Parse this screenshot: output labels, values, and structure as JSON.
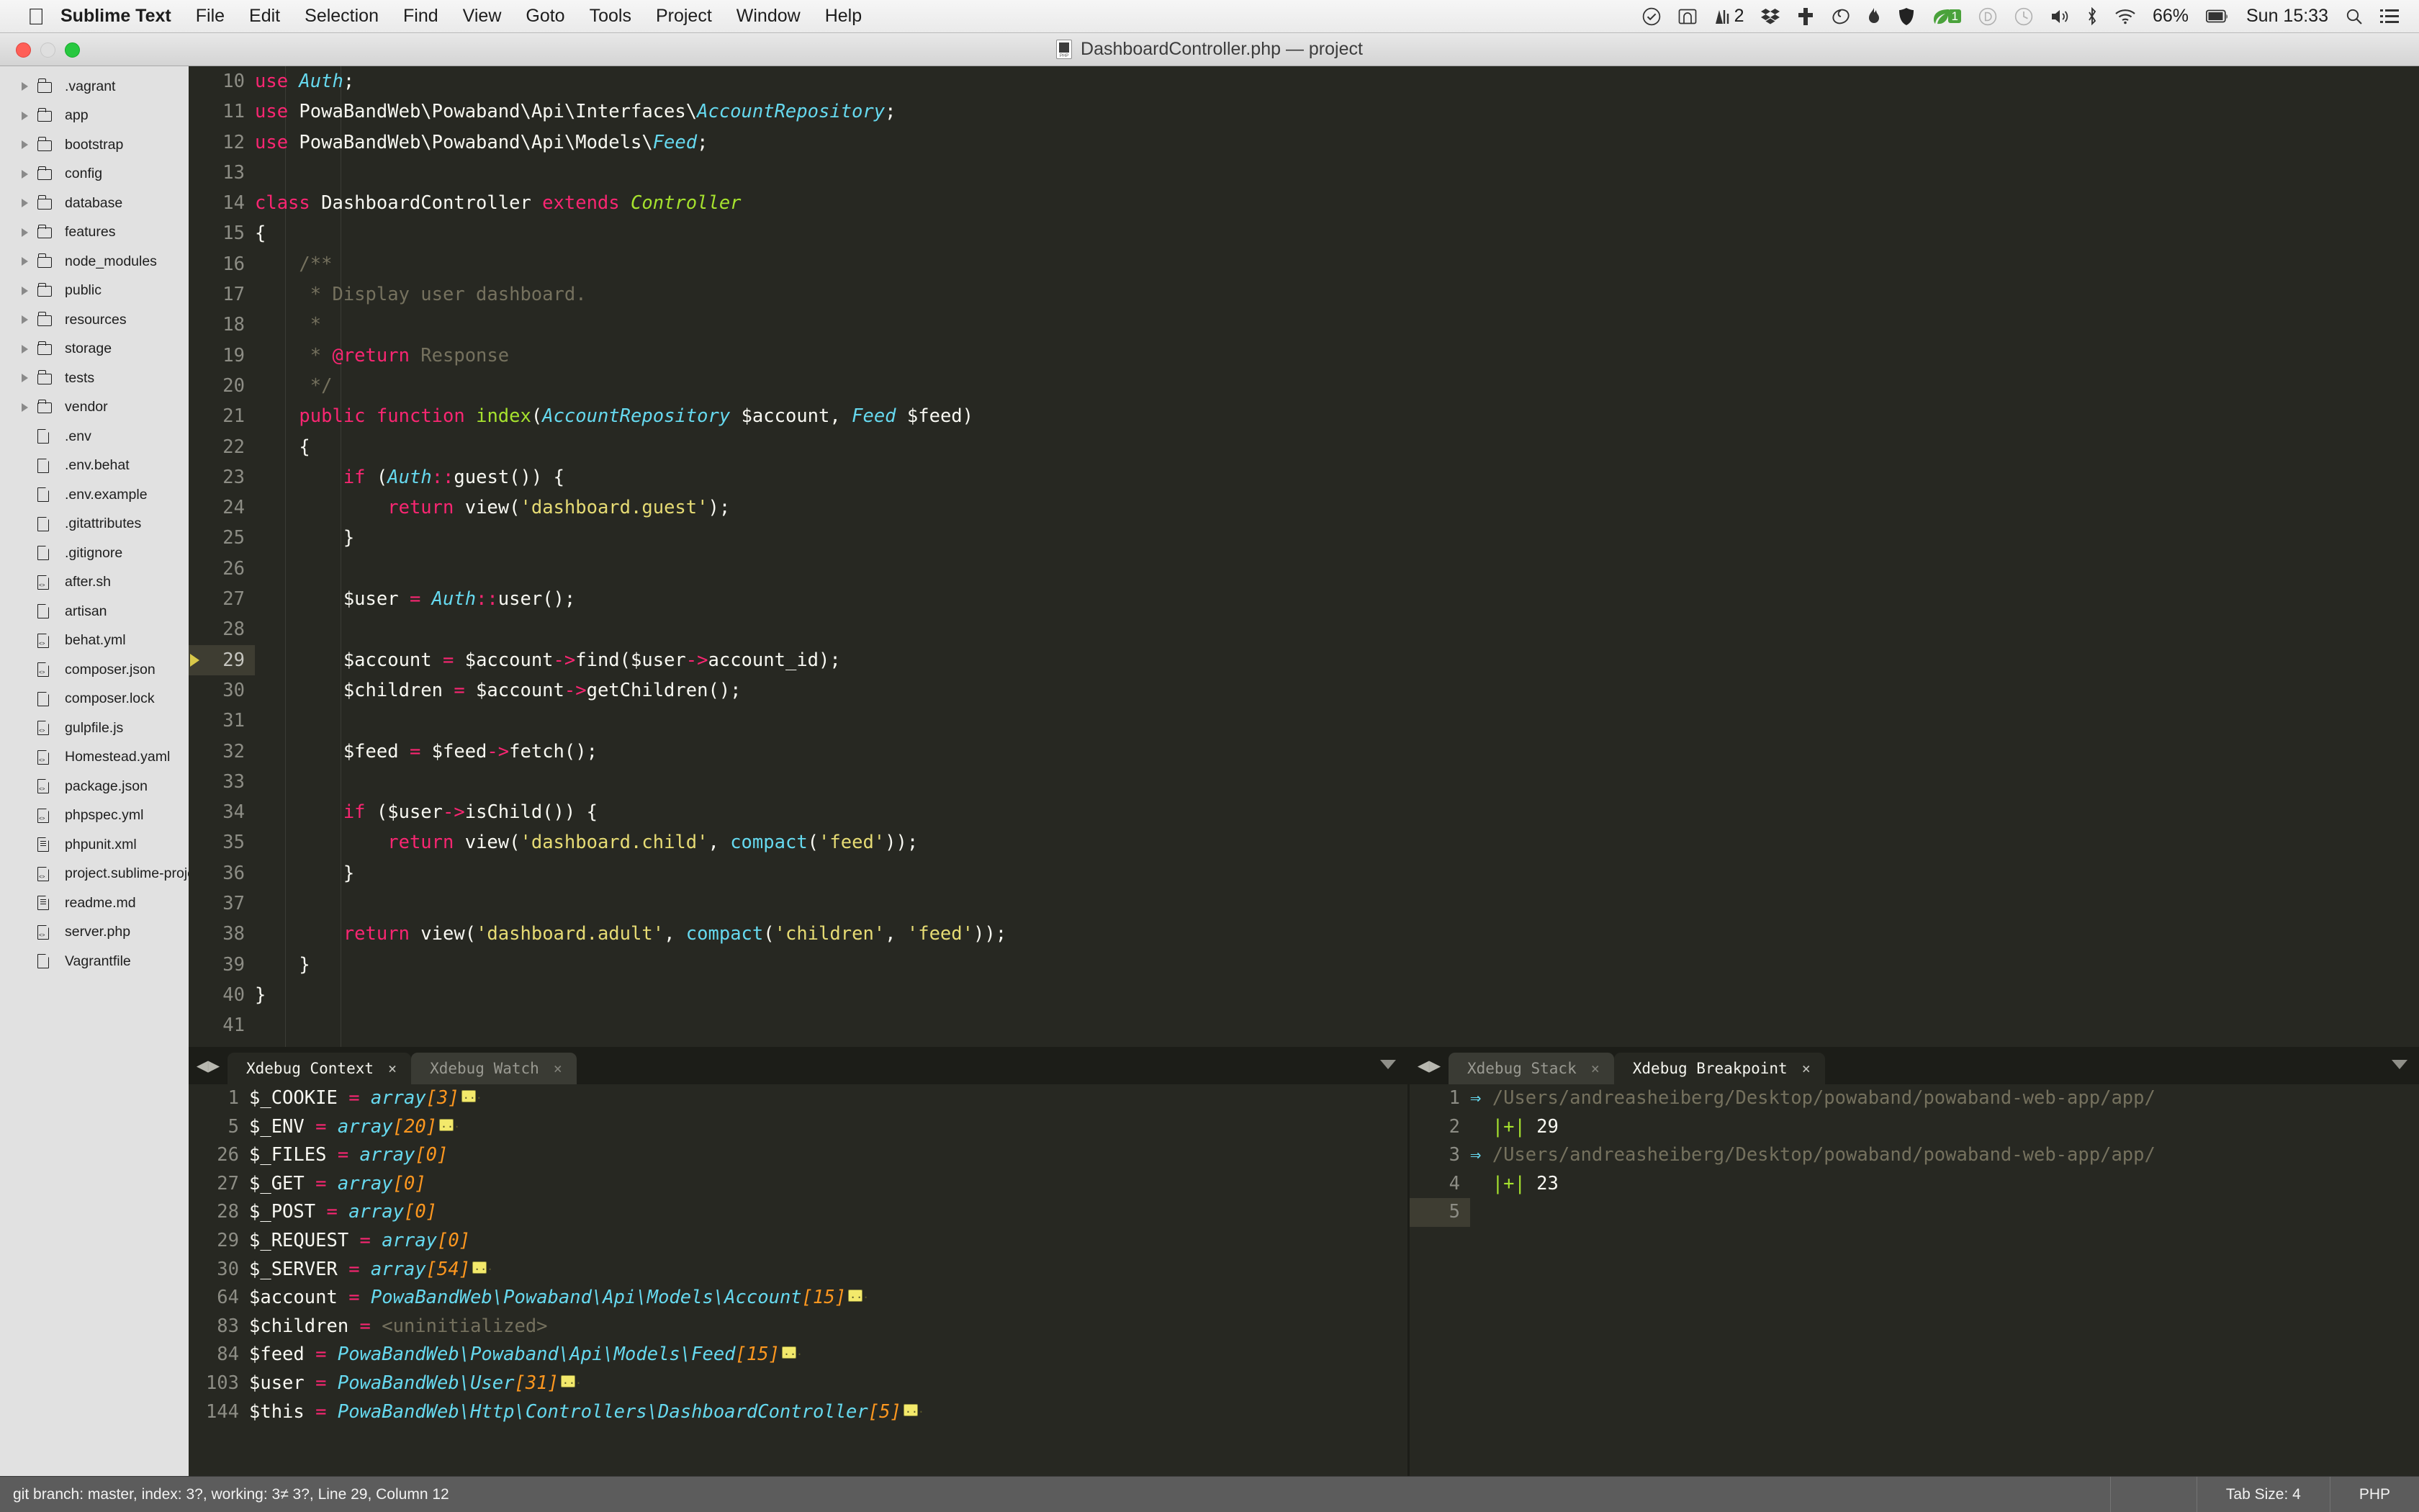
{
  "menubar": {
    "apple_icon": "apple-logo-icon",
    "app_name": "Sublime Text",
    "items": [
      "File",
      "Edit",
      "Selection",
      "Find",
      "View",
      "Goto",
      "Tools",
      "Project",
      "Window",
      "Help"
    ],
    "status_icons": [
      "checkmark-circle-icon",
      "screenshot-icon",
      "audio-levels-icon",
      "dropbox-icon",
      "cross-plugin-icon",
      "spiral-icon",
      "flame-icon",
      "shield-icon",
      "leaf-icon",
      "circled-d-icon",
      "clock-icon",
      "volume-icon",
      "bluetooth-icon",
      "wifi-icon"
    ],
    "audio_levels_count": "2",
    "leaf_badge": "1",
    "battery_percent": "66%",
    "clock": "Sun 15:33",
    "search_icon": "search-icon",
    "notification_icon": "notification-center-icon"
  },
  "window": {
    "title": "DashboardController.php — project",
    "file_icon": "php-file-icon",
    "traffic_lights": [
      "close-button",
      "minimize-button",
      "zoom-button"
    ]
  },
  "sidebar": {
    "folders": [
      ".vagrant",
      "app",
      "bootstrap",
      "config",
      "database",
      "features",
      "node_modules",
      "public",
      "resources",
      "storage",
      "tests",
      "vendor"
    ],
    "files": [
      {
        "name": ".env",
        "kind": "plain"
      },
      {
        "name": ".env.behat",
        "kind": "plain"
      },
      {
        "name": ".env.example",
        "kind": "plain"
      },
      {
        "name": ".gitattributes",
        "kind": "plain"
      },
      {
        "name": ".gitignore",
        "kind": "plain"
      },
      {
        "name": "after.sh",
        "kind": "code"
      },
      {
        "name": "artisan",
        "kind": "plain"
      },
      {
        "name": "behat.yml",
        "kind": "code"
      },
      {
        "name": "composer.json",
        "kind": "code"
      },
      {
        "name": "composer.lock",
        "kind": "plain"
      },
      {
        "name": "gulpfile.js",
        "kind": "code"
      },
      {
        "name": "Homestead.yaml",
        "kind": "code"
      },
      {
        "name": "package.json",
        "kind": "code"
      },
      {
        "name": "phpspec.yml",
        "kind": "code"
      },
      {
        "name": "phpunit.xml",
        "kind": "doc"
      },
      {
        "name": "project.sublime-project",
        "kind": "code"
      },
      {
        "name": "readme.md",
        "kind": "doc"
      },
      {
        "name": "server.php",
        "kind": "code"
      },
      {
        "name": "Vagrantfile",
        "kind": "plain"
      }
    ]
  },
  "editor": {
    "language": "PHP",
    "first_line": 10,
    "breakpoint_line": 29,
    "lines": [
      {
        "n": 10,
        "text": "use Auth;"
      },
      {
        "n": 11,
        "text": "use PowaBandWeb\\Powaband\\Api\\Interfaces\\AccountRepository;"
      },
      {
        "n": 12,
        "text": "use PowaBandWeb\\Powaband\\Api\\Models\\Feed;"
      },
      {
        "n": 13,
        "text": ""
      },
      {
        "n": 14,
        "text": "class DashboardController extends Controller"
      },
      {
        "n": 15,
        "text": "{"
      },
      {
        "n": 16,
        "text": "    /**"
      },
      {
        "n": 17,
        "text": "     * Display user dashboard."
      },
      {
        "n": 18,
        "text": "     *"
      },
      {
        "n": 19,
        "text": "     * @return Response"
      },
      {
        "n": 20,
        "text": "     */"
      },
      {
        "n": 21,
        "text": "    public function index(AccountRepository $account, Feed $feed)"
      },
      {
        "n": 22,
        "text": "    {"
      },
      {
        "n": 23,
        "text": "        if (Auth::guest()) {"
      },
      {
        "n": 24,
        "text": "            return view('dashboard.guest');"
      },
      {
        "n": 25,
        "text": "        }"
      },
      {
        "n": 26,
        "text": ""
      },
      {
        "n": 27,
        "text": "        $user = Auth::user();"
      },
      {
        "n": 28,
        "text": ""
      },
      {
        "n": 29,
        "text": "        $account = $account->find($user->account_id);"
      },
      {
        "n": 30,
        "text": "        $children = $account->getChildren();"
      },
      {
        "n": 31,
        "text": ""
      },
      {
        "n": 32,
        "text": "        $feed = $feed->fetch();"
      },
      {
        "n": 33,
        "text": ""
      },
      {
        "n": 34,
        "text": "        if ($user->isChild()) {"
      },
      {
        "n": 35,
        "text": "            return view('dashboard.child', compact('feed'));"
      },
      {
        "n": 36,
        "text": "        }"
      },
      {
        "n": 37,
        "text": ""
      },
      {
        "n": 38,
        "text": "        return view('dashboard.adult', compact('children', 'feed'));"
      },
      {
        "n": 39,
        "text": "    }"
      },
      {
        "n": 40,
        "text": "}"
      },
      {
        "n": 41,
        "text": ""
      }
    ]
  },
  "bottom_left_panel": {
    "tabs": [
      {
        "label": "Xdebug Context",
        "active": true,
        "close": "×"
      },
      {
        "label": "Xdebug Watch",
        "active": false,
        "close": "×"
      }
    ],
    "rows": [
      {
        "n": "1",
        "name": "$_COOKIE",
        "value": "array",
        "index": "[3]",
        "expand": true
      },
      {
        "n": "5",
        "name": "$_ENV",
        "value": "array",
        "index": "[20]",
        "expand": true
      },
      {
        "n": "26",
        "name": "$_FILES",
        "value": "array",
        "index": "[0]",
        "expand": false
      },
      {
        "n": "27",
        "name": "$_GET",
        "value": "array",
        "index": "[0]",
        "expand": false
      },
      {
        "n": "28",
        "name": "$_POST",
        "value": "array",
        "index": "[0]",
        "expand": false
      },
      {
        "n": "29",
        "name": "$_REQUEST",
        "value": "array",
        "index": "[0]",
        "expand": false
      },
      {
        "n": "30",
        "name": "$_SERVER",
        "value": "array",
        "index": "[54]",
        "expand": true
      },
      {
        "n": "64",
        "name": "$account",
        "value": "PowaBandWeb\\Powaband\\Api\\Models\\Account",
        "index": "[15]",
        "expand": true
      },
      {
        "n": "83",
        "name": "$children",
        "value": "<uninitialized>",
        "index": "",
        "expand": false,
        "uninit": true
      },
      {
        "n": "84",
        "name": "$feed",
        "value": "PowaBandWeb\\Powaband\\Api\\Models\\Feed",
        "index": "[15]",
        "expand": true
      },
      {
        "n": "103",
        "name": "$user",
        "value": "PowaBandWeb\\User",
        "index": "[31]",
        "expand": true
      },
      {
        "n": "144",
        "name": "$this",
        "value": "PowaBandWeb\\Http\\Controllers\\DashboardController",
        "index": "[5]",
        "expand": true
      }
    ]
  },
  "bottom_right_panel": {
    "tabs": [
      {
        "label": "Xdebug Stack",
        "active": false,
        "close": "×"
      },
      {
        "label": "Xdebug Breakpoint",
        "active": true,
        "close": "×"
      }
    ],
    "rows": [
      {
        "n": "1",
        "marker": "=>",
        "text": "/Users/andreasheiberg/Desktop/powaband/powaband-web-app/app/"
      },
      {
        "n": "2",
        "marker": "|+|",
        "text": "29"
      },
      {
        "n": "3",
        "marker": "=>",
        "text": "/Users/andreasheiberg/Desktop/powaband/powaband-web-app/app/"
      },
      {
        "n": "4",
        "marker": "|+|",
        "text": "23"
      },
      {
        "n": "5",
        "marker": "",
        "text": ""
      }
    ]
  },
  "statusbar": {
    "left": "git branch: master, index: 3?, working: 3≠ 3?, Line 29, Column 12",
    "tab_size": "Tab Size: 4",
    "syntax": "PHP"
  },
  "colors": {
    "editor_bg": "#272822",
    "keyword": "#f92672",
    "string": "#e6db74",
    "comment": "#75715e",
    "type": "#66d9ef",
    "function": "#a6e22e",
    "number": "#fd971f",
    "sidebar_bg": "#e1e1e1",
    "statusbar_bg": "#5c5c5c"
  }
}
